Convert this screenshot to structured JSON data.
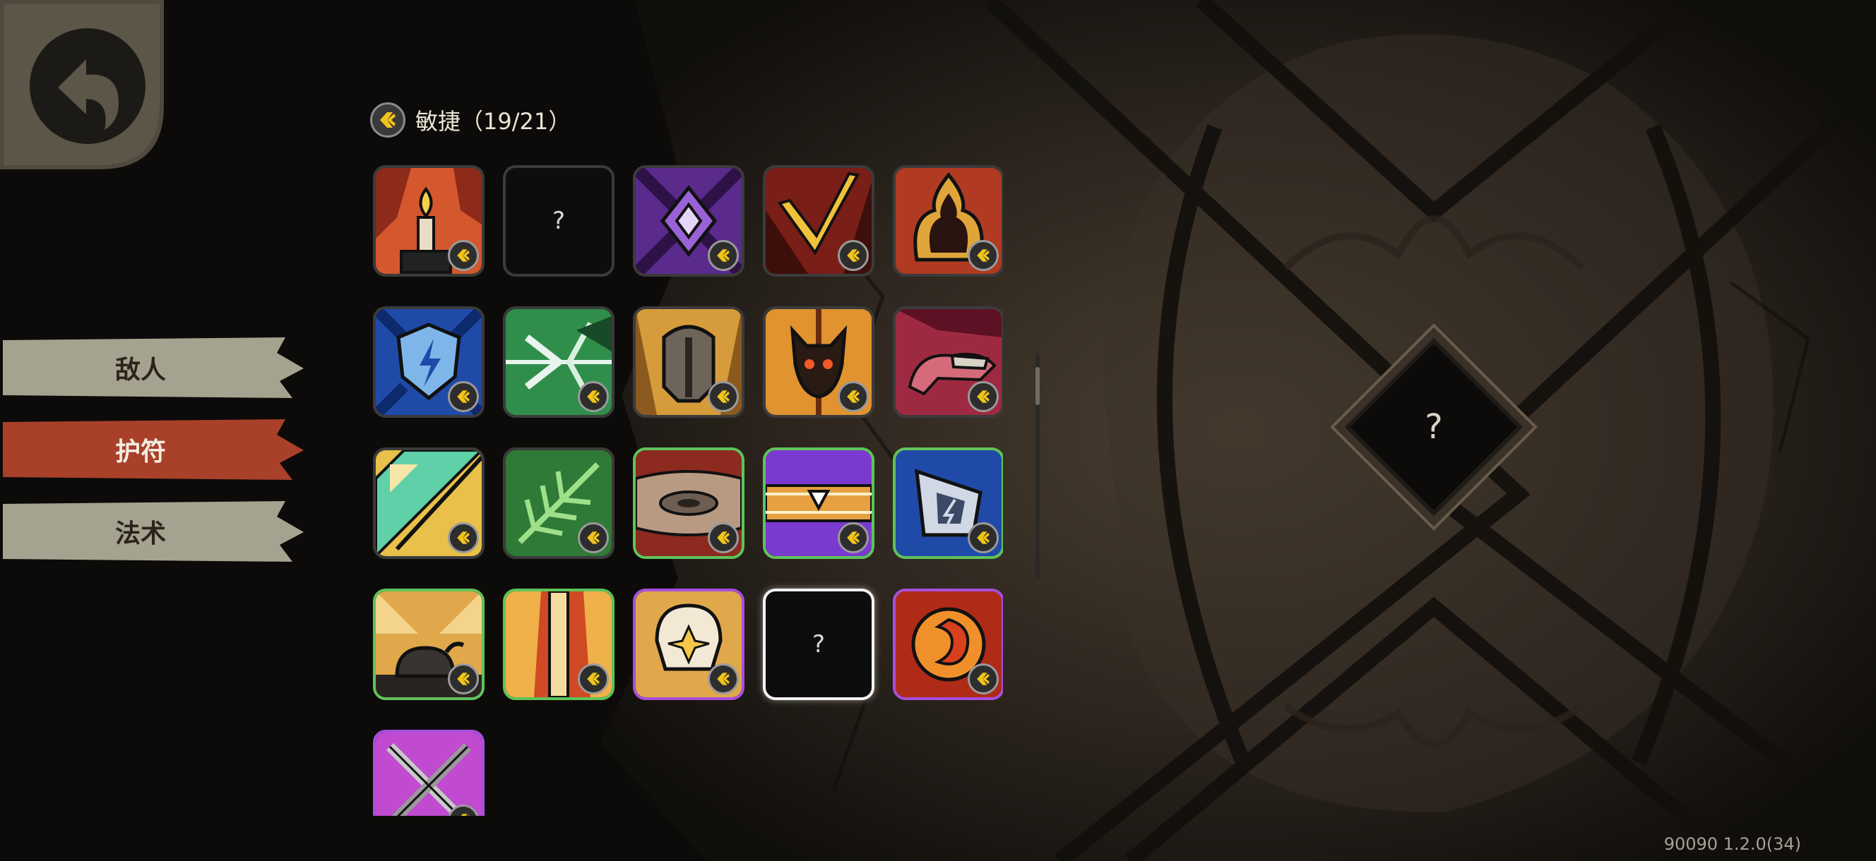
{
  "tabs": [
    {
      "label": "敌人",
      "active": false
    },
    {
      "label": "护符",
      "active": true
    },
    {
      "label": "法术",
      "active": false
    }
  ],
  "header": {
    "label": "敏捷（19/21）",
    "icon": "agility-icon"
  },
  "items": [
    {
      "name": "candle-charm",
      "status": "unlocked"
    },
    {
      "name": "unknown-charm",
      "status": "locked",
      "label": "?"
    },
    {
      "name": "purple-crystal-charm",
      "status": "unlocked"
    },
    {
      "name": "golden-slash-charm",
      "status": "unlocked"
    },
    {
      "name": "flame-shadow-charm",
      "status": "unlocked"
    },
    {
      "name": "lightning-shield-charm",
      "status": "unlocked"
    },
    {
      "name": "green-arrows-charm",
      "status": "unlocked"
    },
    {
      "name": "helmet-charm",
      "status": "unlocked"
    },
    {
      "name": "flame-demon-charm",
      "status": "unlocked"
    },
    {
      "name": "crimson-beast-charm",
      "status": "unlocked"
    },
    {
      "name": "teal-shard-charm",
      "status": "unlocked"
    },
    {
      "name": "green-leaf-charm",
      "status": "unlocked"
    },
    {
      "name": "ring-disc-charm",
      "status": "unlocked"
    },
    {
      "name": "purple-banner-charm",
      "status": "unlocked"
    },
    {
      "name": "blue-shield-charm",
      "status": "unlocked"
    },
    {
      "name": "bomb-charm",
      "status": "unlocked"
    },
    {
      "name": "fire-pillar-charm",
      "status": "unlocked"
    },
    {
      "name": "skull-star-charm",
      "status": "unlocked"
    },
    {
      "name": "unknown-charm-selected",
      "status": "locked",
      "label": "?",
      "selected": true
    },
    {
      "name": "phoenix-swirl-charm",
      "status": "unlocked"
    },
    {
      "name": "crossed-blades-charm",
      "status": "unlocked"
    }
  ],
  "detail": {
    "label": "?"
  },
  "version": "90090 1.2.0(34)",
  "colors": {
    "background": "#0e0c0a",
    "tab_inactive": "#a5a28f",
    "tab_active": "#a8402a",
    "border_common": "#3b3b3b",
    "border_uncommon": "#5fc35a",
    "border_rare": "#a84fdc",
    "selected_border": "#f2f2f2"
  }
}
